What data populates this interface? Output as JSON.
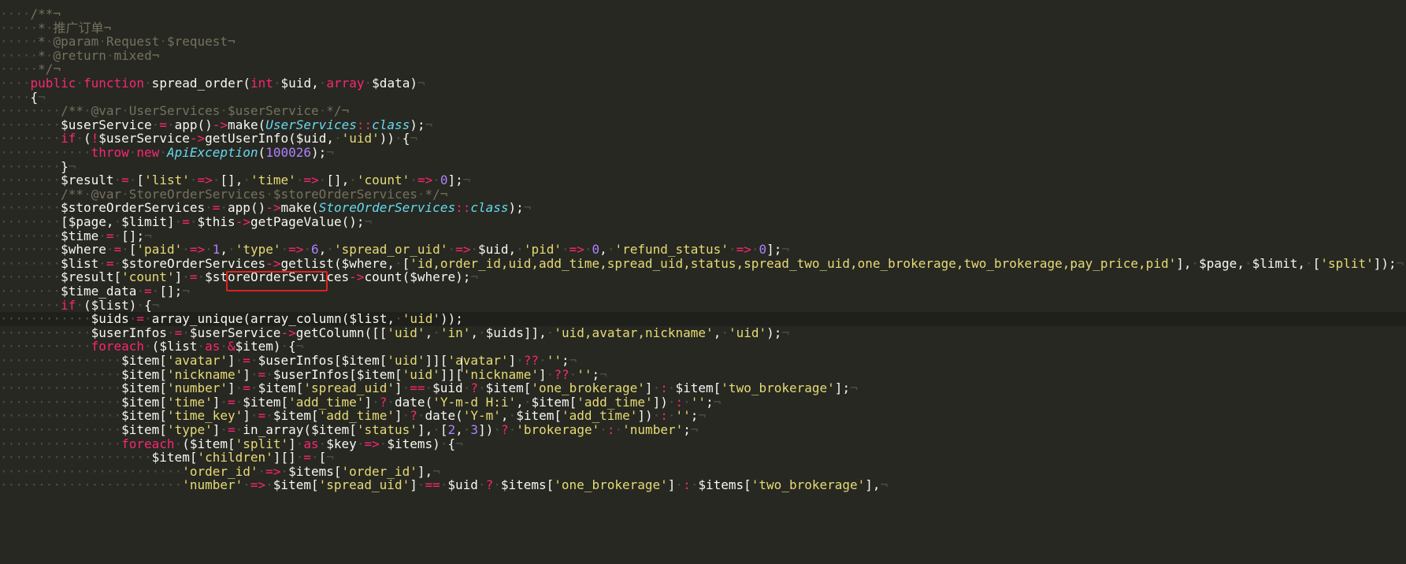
{
  "editor": {
    "theme": {
      "background": "#272822",
      "comment": "#75715e",
      "keyword": "#f92672",
      "string": "#e6db74",
      "number": "#ae81ff",
      "class": "#66d9ef",
      "variable": "#f8f8f2",
      "text": "#f8f8f2",
      "whitespace": "#4f4f46",
      "highlight_box": "#e02020"
    },
    "highlighted_text": "'type' => 6,",
    "lines": [
      {
        "indent": "",
        "code": "/**¬"
      },
      {
        "indent": "",
        "code": " * 推广订单¬"
      },
      {
        "indent": "",
        "code": " * @param Request $request¬"
      },
      {
        "indent": "",
        "code": " * @return mixed¬"
      },
      {
        "indent": "",
        "code": " */¬"
      },
      {
        "indent": "",
        "code": "public function spread_order(int $uid, array $data)¬"
      },
      {
        "indent": "",
        "code": "{¬"
      },
      {
        "indent": "    ",
        "code": "/** @var UserServices $userService */¬"
      },
      {
        "indent": "    ",
        "code": "$userService = app()->make(UserServices::class);¬"
      },
      {
        "indent": "    ",
        "code": "if (!$userService->getUserInfo($uid, 'uid')) {¬"
      },
      {
        "indent": "        ",
        "code": "throw new ApiException(100026);¬"
      },
      {
        "indent": "    ",
        "code": "}¬"
      },
      {
        "indent": "    ",
        "code": "$result = ['list' => [], 'time' => [], 'count' => 0];¬"
      },
      {
        "indent": "    ",
        "code": "/** @var StoreOrderServices $storeOrderServices */¬"
      },
      {
        "indent": "    ",
        "code": "$storeOrderServices = app()->make(StoreOrderServices::class);¬"
      },
      {
        "indent": "    ",
        "code": "[$page, $limit] = $this->getPageValue();¬"
      },
      {
        "indent": "    ",
        "code": "$time = [];¬"
      },
      {
        "indent": "    ",
        "code": "$where = ['paid' => 1, 'type' => 6, 'spread_or_uid' => $uid, 'pid' => 0, 'refund_status' => 0];¬"
      },
      {
        "indent": "    ",
        "code": "$list = $storeOrderServices->getlist($where, ['id,order_id,uid,add_time,spread_uid,status,spread_two_uid,one_brokerage,two_brokerage,pay_price,pid'], $page, $limit, ['split']);¬"
      },
      {
        "indent": "    ",
        "code": "$result['count'] = $storeOrderServices->count($where);¬"
      },
      {
        "indent": "    ",
        "code": "$time_data = [];¬"
      },
      {
        "indent": "    ",
        "code": "if ($list) {¬"
      },
      {
        "indent": "        ",
        "code": "$uids = array_unique(array_column($list, 'uid'));"
      },
      {
        "indent": "        ",
        "code": "$userInfos = $userService->getColumn([['uid', 'in', $uids]], 'uid,avatar,nickname', 'uid');¬"
      },
      {
        "indent": "        ",
        "code": "foreach ($list as &$item) {¬"
      },
      {
        "indent": "            ",
        "code": "$item['avatar'] = $userInfos[$item['uid']]['avatar'] ?? '';¬"
      },
      {
        "indent": "            ",
        "code": "$item['nickname'] = $userInfos[$item['uid']]['nickname'] ?? '';¬"
      },
      {
        "indent": "            ",
        "code": "$item['number'] = $item['spread_uid'] == $uid ? $item['one_brokerage'] : $item['two_brokerage'];¬"
      },
      {
        "indent": "            ",
        "code": "$item['time'] = $item['add_time'] ? date('Y-m-d H:i', $item['add_time']) : '';¬"
      },
      {
        "indent": "            ",
        "code": "$item['time_key'] = $item['add_time'] ? date('Y-m', $item['add_time']) : '';¬"
      },
      {
        "indent": "            ",
        "code": "$item['type'] = in_array($item['status'], [2, 3]) ? 'brokerage' : 'number';¬"
      },
      {
        "indent": "            ",
        "code": "foreach ($item['split'] as $key => $items) {¬"
      },
      {
        "indent": "                ",
        "code": "$item['children'][] = [¬"
      },
      {
        "indent": "                    ",
        "code": "'order_id' => $items['order_id'],¬"
      },
      {
        "indent": "                    ",
        "code": "'number' => $item['spread_uid'] == $uid ? $items['one_brokerage'] : $items['two_brokerage'],¬"
      }
    ]
  }
}
